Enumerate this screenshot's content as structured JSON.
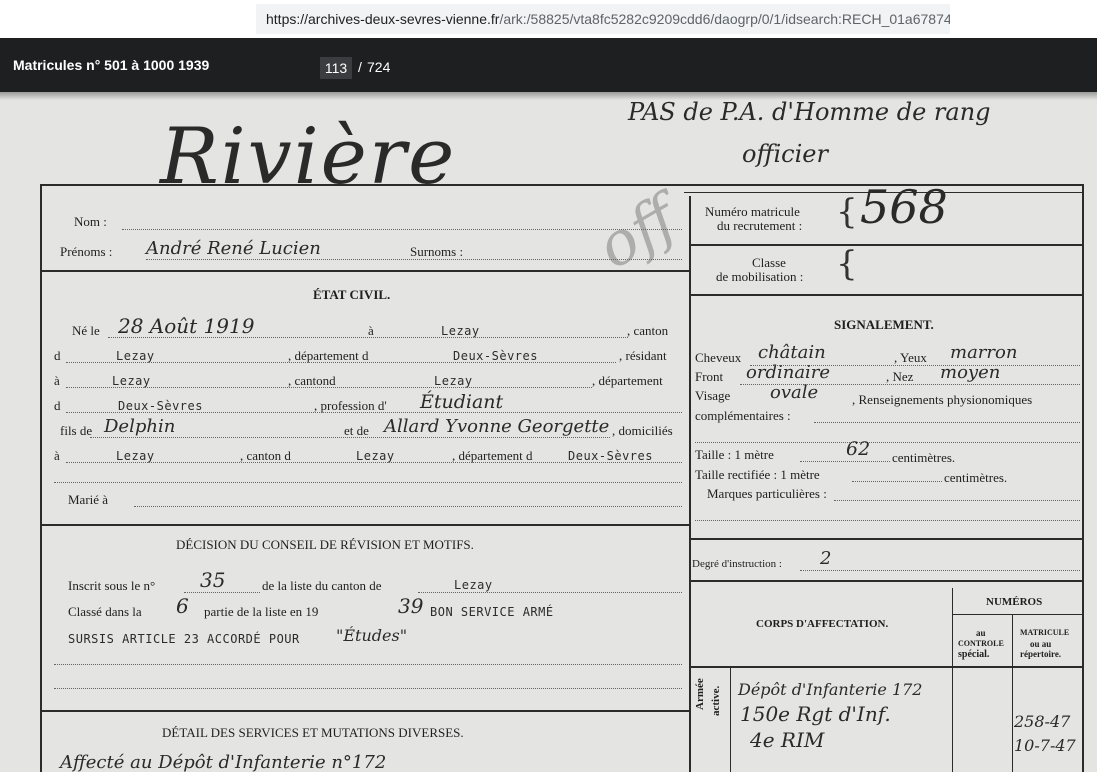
{
  "url": {
    "host": "https://archives-deux-sevres-vienne.fr",
    "path": "/ark:/58825/vta8fc5282c9209cdd6/daogrp/0/1/idsearch:RECH_01a67874"
  },
  "viewer": {
    "title": "Matricules n° 501 à 1000 1939",
    "current_page": "113",
    "separator": "/",
    "total_pages": "724"
  },
  "document": {
    "annotation": {
      "line1": "PAS de P.A. d'Homme de rang",
      "line2": "officier"
    },
    "surname_hw": "Rivière",
    "watermark": "off",
    "nom_label": "Nom :",
    "prenoms_label": "Prénoms :",
    "prenoms_hw": "André René Lucien",
    "surnoms_label": "Surnoms :",
    "matricule_label_1": "Numéro matricule",
    "matricule_label_2": "du recrutement :",
    "matricule_hw": "568",
    "classe_label_1": "Classe",
    "classe_label_2": "de mobilisation :",
    "etat_civil": {
      "heading": "ÉTAT CIVIL.",
      "ne_le": "Né le",
      "date_hw": "28 Août 1919",
      "a": "à",
      "lieu_naissance": "Lezay",
      "canton": ", canton",
      "d": "d",
      "canton_naissance": "Lezay",
      "departement_d": ", département d",
      "dept_naissance": "Deux-Sèvres",
      "residant": ", résidant",
      "a2": "à",
      "residence": "Lezay",
      "cantond": ", cantond",
      "canton_residence": "Lezay",
      "departement": ", département",
      "d2": "d",
      "dept_residence": "Deux-Sèvres",
      "profession_label": ", profession d'",
      "profession_hw": "Étudiant",
      "fils_de": "fils de",
      "pere_hw": "Delphin",
      "et_de": "et de",
      "mere_hw": "Allard Yvonne Georgette",
      "domicilies": ", domiciliés",
      "a3": "à",
      "domicile": "Lezay",
      "canton_d": ", canton d",
      "canton_domicile": "Lezay",
      "departement_d2": ", département d",
      "dept_domicile": "Deux-Sèvres",
      "marie": "Marié à"
    },
    "signalement": {
      "heading": "SIGNALEMENT.",
      "cheveux_label": "Cheveux",
      "cheveux_hw": "châtain",
      "yeux_label": ", Yeux",
      "yeux_hw": "marron",
      "front_label": "Front",
      "front_hw": "ordinaire",
      "nez_label": ", Nez",
      "nez_hw": "moyen",
      "visage_label": "Visage",
      "visage_hw": "ovale",
      "renseignements": ", Renseignements physionomiques",
      "complementaires": "complémentaires :",
      "taille_label": "Taille : 1 mètre",
      "taille_hw": "62",
      "centimetres": "centimètres.",
      "taille_rect_label": "Taille rectifiée : 1 mètre",
      "centimetres2": "centimètres.",
      "marques": "Marques particulières :"
    },
    "degre_label": "Degré d'instruction :",
    "degre_hw": "2",
    "decision": {
      "heading": "DÉCISION DU CONSEIL DE RÉVISION ET MOTIFS.",
      "inscrit": "Inscrit sous le n°",
      "inscrit_hw": "35",
      "liste_canton": "de la liste du canton de",
      "canton_hw": "Lezay",
      "classe_dans": "Classé dans la",
      "partie_hw": "6",
      "partie": "partie de la liste en 19",
      "annee_hw": "39",
      "bon_service": "BON SERVICE ARMÉ",
      "sursis": "SURSIS ARTICLE 23 ACCORDÉ POUR",
      "sursis_hw": "\"Études\""
    },
    "corps": {
      "heading": "CORPS D'AFFECTATION.",
      "numeros": "NUMÉROS",
      "au_controle_1": "au",
      "au_controle_2": "CONTROLE",
      "au_controle_3": "spécial.",
      "matricule_1": "MATRICULE",
      "matricule_2": "ou au",
      "matricule_3": "répertoire.",
      "armee": "Armée",
      "active": "active.",
      "entry1_hw": "Dépôt d'Infanterie 172",
      "entry2_hw": "150e Rgt d'Inf.",
      "entry3_hw": "4e RIM",
      "num1_hw": "258-47",
      "num2_hw": "10-7-47"
    },
    "detail": {
      "heading": "DÉTAIL DES SERVICES ET MUTATIONS DIVERSES.",
      "line_hw": "Affecté au Dépôt d'Infanterie n°172"
    }
  }
}
